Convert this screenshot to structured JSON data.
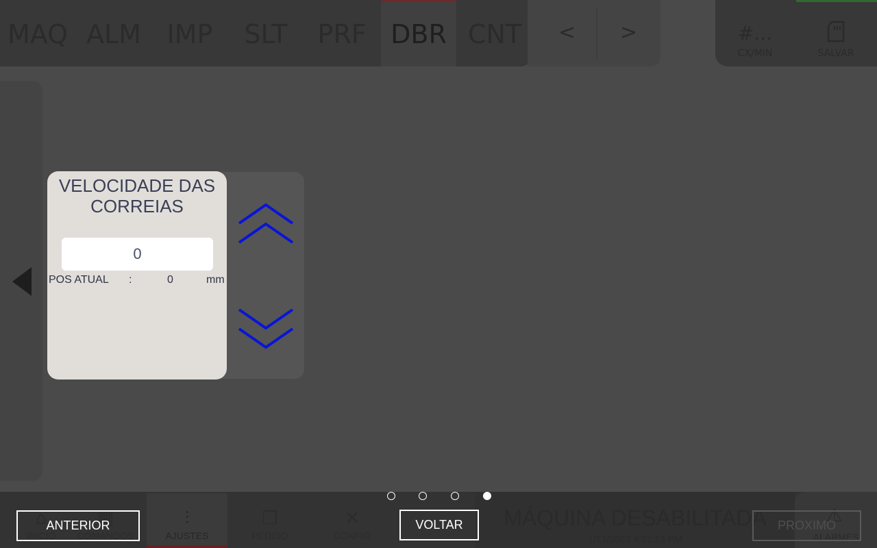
{
  "top_tabs": [
    "MAQ",
    "ALM",
    "IMP",
    "SLT",
    "PRF",
    "DBR",
    "CNT"
  ],
  "nav": {
    "prev": "<",
    "next": ">"
  },
  "top_right": {
    "counter_icon": "#...",
    "counter_label": "CX/MIN",
    "save_label": "SALVAR"
  },
  "card": {
    "title_line1": "VELOCIDADE DAS",
    "title_line2": "CORREIAS",
    "value": "0",
    "pos_label": "POS ATUAL",
    "pos_sep": ":",
    "pos_value": "0",
    "pos_unit": "mm"
  },
  "pagination": {
    "total": 4,
    "active": 4
  },
  "buttons": {
    "anterior": "ANTERIOR",
    "voltar": "VOLTAR",
    "proximo": "PROXIMO"
  },
  "bottom_nav": [
    {
      "label": "INICIO"
    },
    {
      "label": "COMANDOS"
    },
    {
      "label": "AJUSTES"
    },
    {
      "label": "PEDIDO"
    },
    {
      "label": "CONFIG"
    }
  ],
  "status": {
    "main": "MÁQUINA DESABILITADA",
    "datetime": "1/17/2023 4:21:13 PM",
    "alarm_label": "ALARMES"
  },
  "colors": {
    "chevron": "#0a14d6",
    "card_bg": "#e1deda",
    "active_tab_accent": "#6d2a2a",
    "status_accent": "#2f6b2f"
  },
  "icons": {
    "up": "double-chevron-up-icon",
    "down": "double-chevron-down-icon",
    "left": "left-triangle-icon",
    "save": "sd-card-icon",
    "alarm": "warning-icon"
  }
}
